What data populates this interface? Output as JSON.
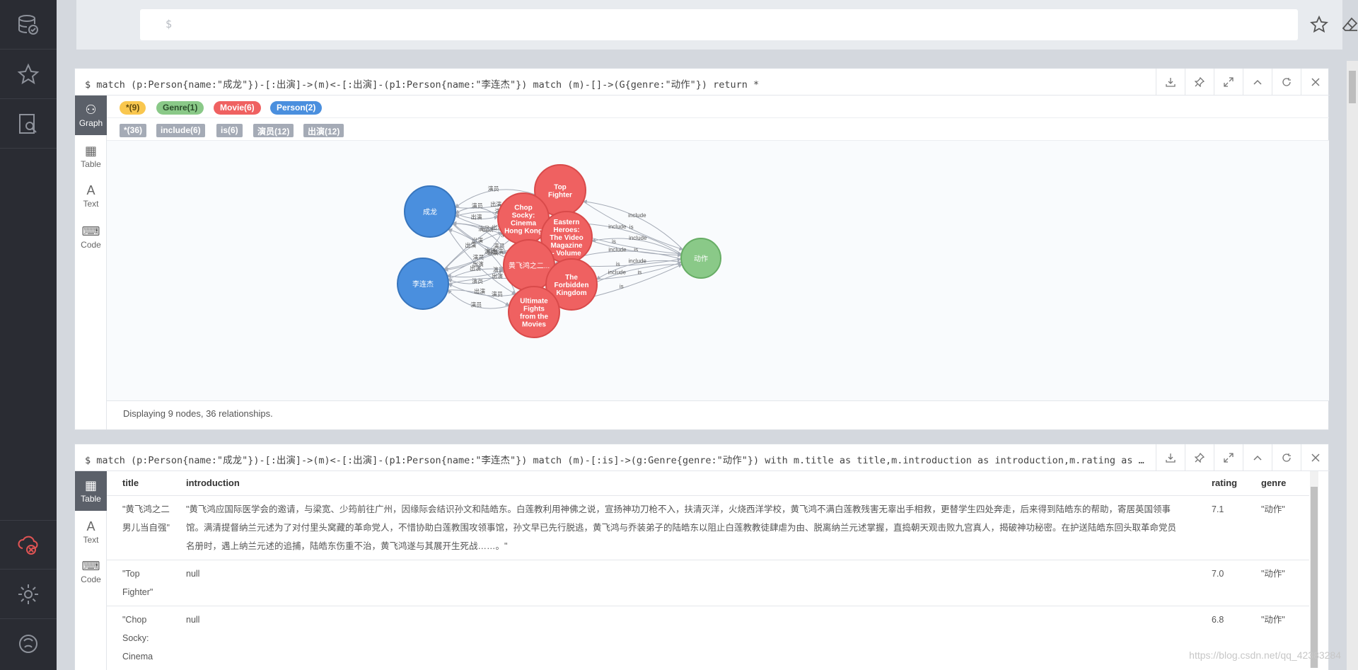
{
  "editor": {
    "prompt": "$"
  },
  "graph_frame": {
    "command": "$ match (p:Person{name:\"成龙\"})-[:出演]->(m)<-[:出演]-(p1:Person{name:\"李连杰\"}) match (m)-[]->(G{genre:\"动作\"}) return *",
    "views": [
      "Graph",
      "Table",
      "Text",
      "Code"
    ],
    "node_labels": [
      {
        "text": "*(9)",
        "color": "#f9c74f"
      },
      {
        "text": "Genre(1)",
        "color": "#8ac988"
      },
      {
        "text": "Movie(6)",
        "color": "#ef6161"
      },
      {
        "text": "Person(2)",
        "color": "#4a8fde"
      }
    ],
    "rel_types": [
      "*(36)",
      "include(6)",
      "is(6)",
      "演员(12)",
      "出演(12)"
    ],
    "nodes": [
      {
        "id": "chenglong",
        "label": "成龙",
        "color": "#4a8fde"
      },
      {
        "id": "lilianjie",
        "label": "李连杰",
        "color": "#4a8fde"
      },
      {
        "id": "topfighter",
        "label": "Top Fighter",
        "color": "#ef6161"
      },
      {
        "id": "chopsocky",
        "label": "Chop Socky: Cinema Hong Kong",
        "color": "#ef6161"
      },
      {
        "id": "eastern",
        "label": "Eastern Heroes: The Video Magazine - Volume",
        "color": "#ef6161"
      },
      {
        "id": "huangfeihong",
        "label": "黄飞鸿之二...",
        "color": "#ef6161"
      },
      {
        "id": "forbidden",
        "label": "The Forbidden Kingdom",
        "color": "#ef6161"
      },
      {
        "id": "ultimate",
        "label": "Ultimate Fights from the Movies",
        "color": "#ef6161"
      },
      {
        "id": "dongzuo",
        "label": "动作",
        "color": "#8ac988"
      }
    ],
    "edge_labels": [
      "演员",
      "出演",
      "include",
      "is"
    ],
    "status": "Displaying 9 nodes, 36 relationships."
  },
  "table_frame": {
    "command": "$ match (p:Person{name:\"成龙\"})-[:出演]->(m)<-[:出演]-(p1:Person{name:\"李连杰\"}) match (m)-[:is]->(g:Genre{genre:\"动作\"}) with m.title as title,m.introduction as introduction,m.rating as rating,g.genre as genre return *",
    "views": [
      "Table",
      "Text",
      "Code"
    ],
    "columns": [
      "title",
      "introduction",
      "rating",
      "genre"
    ],
    "rows": [
      {
        "title": "\"黄飞鸿之二男儿当自强\"",
        "introduction": "\"黄飞鸿应国际医学会的邀请，与梁宽、少筠前往广州，因缘际会结识孙文和陆皓东。白莲教利用神佛之说，宣扬神功刀枪不入，扶清灭洋，火烧西洋学校，黄飞鸿不满白莲教残害无辜出手相救，更替学生四处奔走，后来得到陆皓东的帮助，寄居英国领事馆。满清提督纳兰元述为了对付里头窝藏的革命党人，不惜协助白莲教围攻领事馆，孙文早已先行脱逃，黄飞鸿与乔装弟子的陆皓东以阻止白莲教教徒肆虐为由、脱离纳兰元述掌握，直捣朝天观击败九宫真人，揭破神功秘密。在护送陆皓东回头取革命党员名册时，遇上纳兰元述的追捕，陆皓东伤重不治，黄飞鸿遂与其展开生死战……。\"",
        "rating": "7.1",
        "genre": "\"动作\""
      },
      {
        "title": "\"Top Fighter\"",
        "introduction": "null",
        "rating": "7.0",
        "genre": "\"动作\""
      },
      {
        "title": "\"Chop Socky: Cinema Hong",
        "introduction": "null",
        "rating": "6.8",
        "genre": "\"动作\""
      }
    ]
  },
  "watermark": "https://blog.csdn.net/qq_42383284"
}
